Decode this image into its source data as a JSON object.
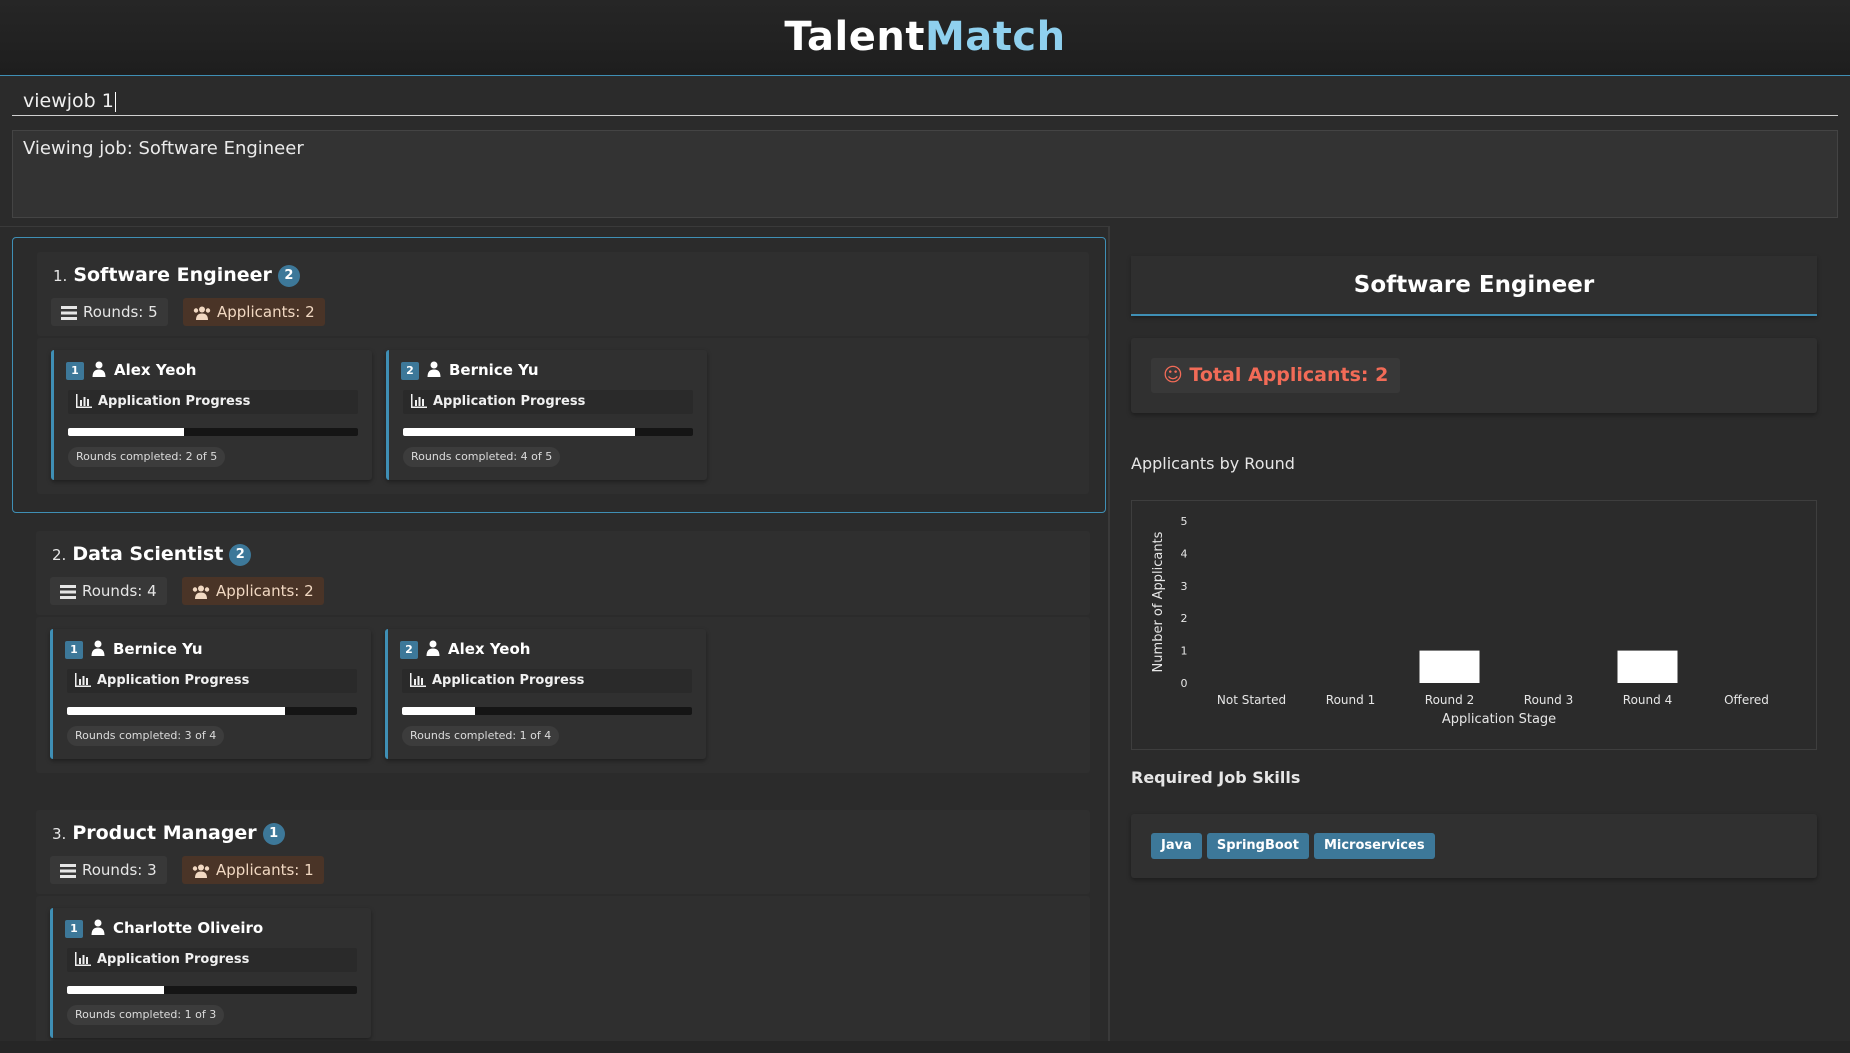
{
  "app": {
    "title_part1": "Talent",
    "title_part2": "Match"
  },
  "command": {
    "value": "viewjob 1"
  },
  "result": {
    "text": "Viewing job: Software Engineer"
  },
  "jobs": [
    {
      "index": "1.",
      "title": "Software Engineer",
      "count": "2",
      "rounds_label": "Rounds: 5",
      "applicants_label": "Applicants: 2",
      "applicants": [
        {
          "num": "1",
          "name": "Alex Yeoh",
          "progress_label": "Application Progress",
          "progress": 0.4,
          "rounds_text": "Rounds completed: 2 of 5"
        },
        {
          "num": "2",
          "name": "Bernice Yu",
          "progress_label": "Application Progress",
          "progress": 0.8,
          "rounds_text": "Rounds completed: 4 of 5"
        }
      ]
    },
    {
      "index": "2.",
      "title": "Data Scientist",
      "count": "2",
      "rounds_label": "Rounds: 4",
      "applicants_label": "Applicants: 2",
      "applicants": [
        {
          "num": "1",
          "name": "Bernice Yu",
          "progress_label": "Application Progress",
          "progress": 0.75,
          "rounds_text": "Rounds completed: 3 of 4"
        },
        {
          "num": "2",
          "name": "Alex Yeoh",
          "progress_label": "Application Progress",
          "progress": 0.25,
          "rounds_text": "Rounds completed: 1 of 4"
        }
      ]
    },
    {
      "index": "3.",
      "title": "Product Manager",
      "count": "1",
      "rounds_label": "Rounds: 3",
      "applicants_label": "Applicants: 1",
      "applicants": [
        {
          "num": "1",
          "name": "Charlotte Oliveiro",
          "progress_label": "Application Progress",
          "progress": 0.333,
          "rounds_text": "Rounds completed: 1 of 3"
        }
      ]
    }
  ],
  "detail": {
    "title": "Software Engineer",
    "total_label": "Total Applicants: 2",
    "chart_heading": "Applicants by Round",
    "skills_heading": "Required Job Skills",
    "skills": [
      "Java",
      "SpringBoot",
      "Microservices"
    ]
  },
  "colors": {
    "accent": "#3f8fb5",
    "badge": "#3d7899",
    "total_text": "#f26b57",
    "applicants_pill": "#4a3427"
  },
  "chart_data": {
    "type": "bar",
    "categories": [
      "Not Started",
      "Round 1",
      "Round 2",
      "Round 3",
      "Round 4",
      "Offered"
    ],
    "values": [
      0,
      0,
      1,
      0,
      1,
      0
    ],
    "xlabel": "Application Stage",
    "ylabel": "Number of Applicants",
    "ylim": [
      0,
      5
    ],
    "yticks": [
      0,
      1,
      2,
      3,
      4,
      5
    ],
    "grid": false
  }
}
